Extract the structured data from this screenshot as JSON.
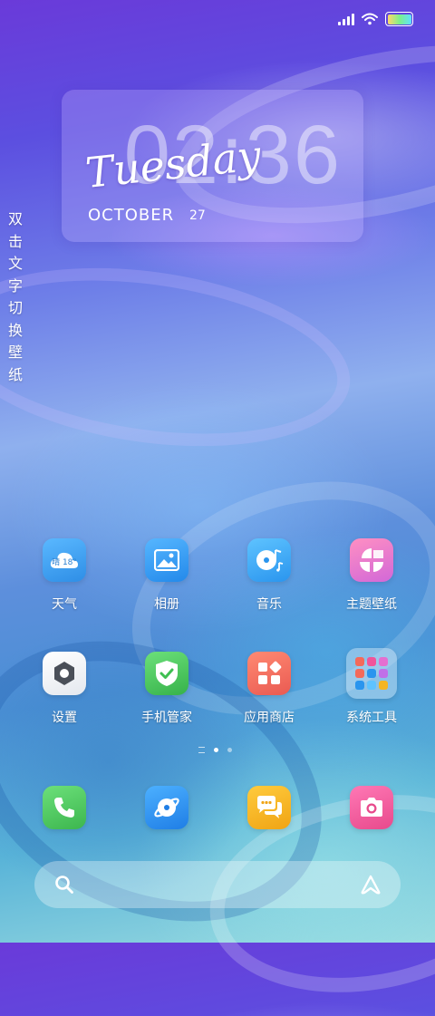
{
  "clock": {
    "time": "02:36",
    "day": "Tuesday",
    "month": "OCTOBER",
    "date": "27"
  },
  "hint": "双击文字切换壁纸",
  "apps_row1": [
    {
      "label": "天气",
      "badge": "晴 18°"
    },
    {
      "label": "相册"
    },
    {
      "label": "音乐"
    },
    {
      "label": "主题壁纸"
    }
  ],
  "apps_row2": [
    {
      "label": "设置"
    },
    {
      "label": "手机管家"
    },
    {
      "label": "应用商店"
    },
    {
      "label": "系统工具"
    }
  ],
  "page_indicator": {
    "pages": 2,
    "current": 1
  },
  "colors": {
    "weather": "#3ea0f0",
    "gallery": "#2f9bf0",
    "music": "#34a8f5",
    "theme": "#f27bb0",
    "settings": "#f2f4f7",
    "security": "#4cc85b",
    "store": "#f46a5a",
    "phone": "#48c75a",
    "browser": "#2a8ff0",
    "messages": "#f5b521",
    "camera": "#f0559a"
  }
}
